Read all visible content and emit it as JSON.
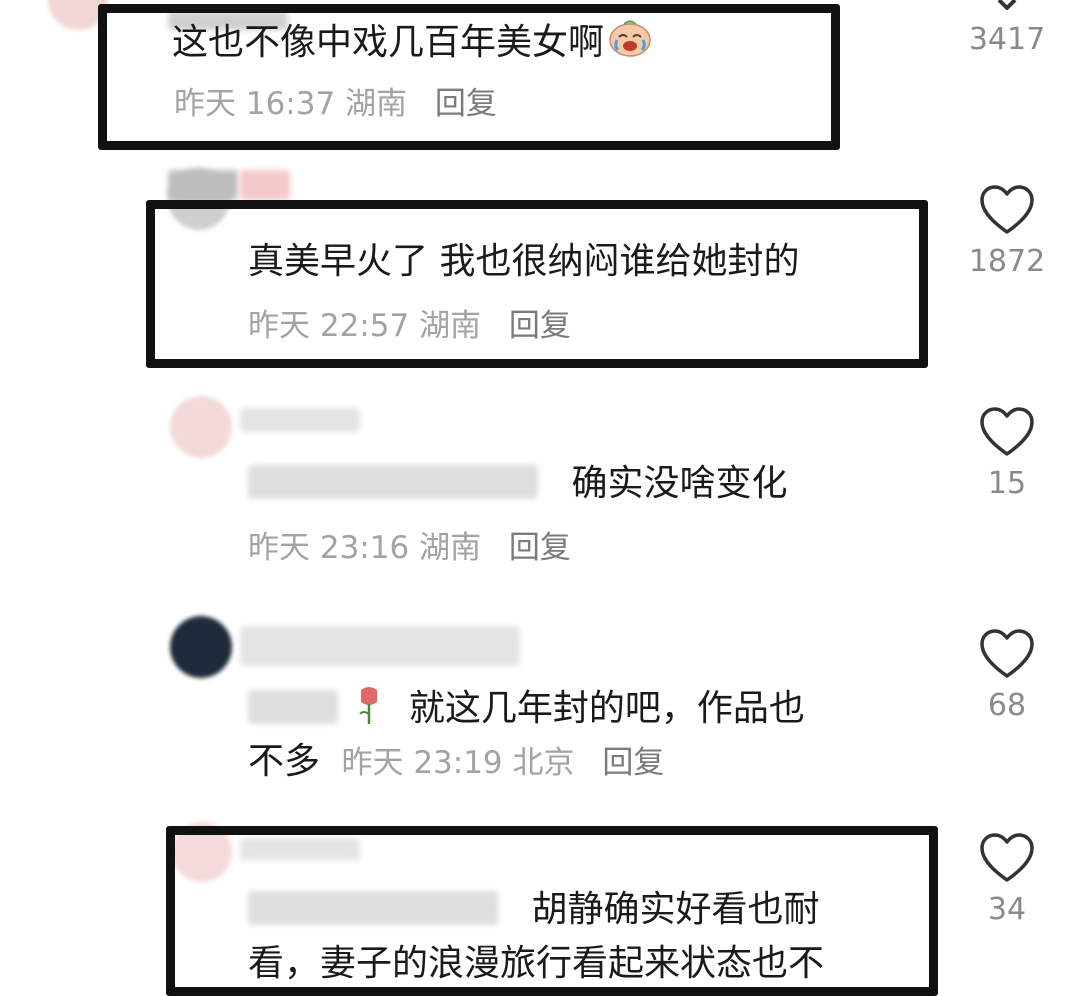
{
  "comments": [
    {
      "text": "这也不像中戏几百年美女啊",
      "time": "昨天 16:37",
      "location": "湖南",
      "reply": "回复",
      "likes": "3417"
    },
    {
      "text": "真美早火了 我也很纳闷谁给她封的",
      "time": "昨天 22:57",
      "location": "湖南",
      "reply": "回复",
      "likes": "1872"
    },
    {
      "text": "确实没啥变化",
      "time": "昨天 23:16",
      "location": "湖南",
      "reply": "回复",
      "likes": "15"
    },
    {
      "text_line1": "就这几年封的吧，作品也",
      "text_line2": "不多",
      "time": "昨天 23:19",
      "location": "北京",
      "reply": "回复",
      "likes": "68"
    },
    {
      "text_line1": "胡静确实好看也耐",
      "text_line2": "看，妻子的浪漫旅行看起来状态也不",
      "likes": "34"
    }
  ],
  "colors": {
    "text": "#1a1a1a",
    "meta": "#a3a3a3",
    "reply": "#7b7b7b",
    "frame": "#111111"
  },
  "icons": {
    "like": "heart-outline-icon",
    "emoji": "crying-laughing-emoji",
    "rose": "rose-emoji"
  }
}
